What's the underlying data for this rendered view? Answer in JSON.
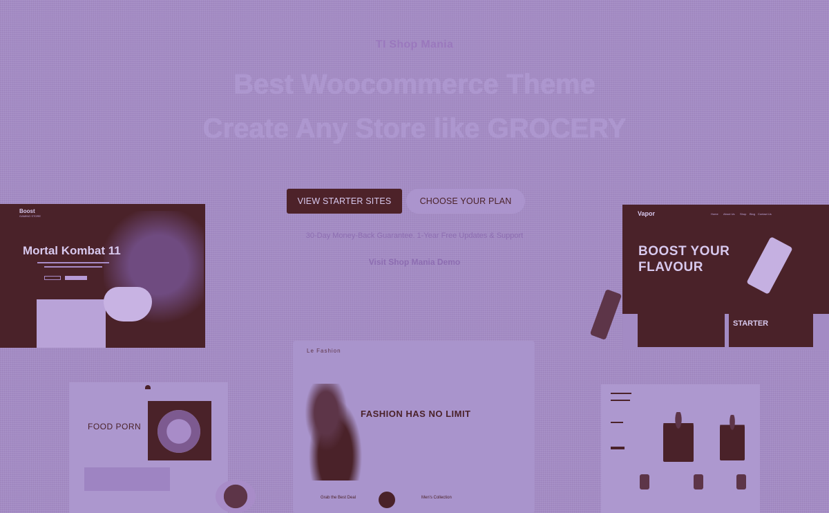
{
  "hero": {
    "eyebrow": "TI Shop Mania",
    "headline_1": "Best Woocommerce Theme",
    "headline_2": "Create Any Store like GROCERY",
    "primary_button": "VIEW STARTER SITES",
    "secondary_button": "CHOOSE YOUR PLAN",
    "note": "30-Day Money-Back Guarantee. 1-Year Free Updates & Support",
    "cta_link": "Visit Shop Mania Demo"
  },
  "previews": {
    "mortal_kombat": {
      "brand": "Boost",
      "brand_sub": "GAMING STORE",
      "title": "Mortal Kombat 11"
    },
    "vapor": {
      "logo": "Vapor",
      "nav": [
        "Home",
        "About Us",
        "Shop",
        "Blog",
        "Contact Us"
      ],
      "title_line_1": "BOOST YOUR",
      "title_line_2": "FLAVOUR",
      "tile_1": "",
      "tile_2": "STARTER"
    },
    "fashion": {
      "logo": "Le Fashion",
      "title": "FASHION HAS NO LIMIT",
      "footer_1": "Grab the Best Deal",
      "footer_2": "Men's Collection"
    },
    "food": {
      "title": "FOOD PORN"
    }
  },
  "colors": {
    "background": "#a38bc4",
    "dark": "#4a2229",
    "heading": "#ad97cf",
    "muted": "#8d6db1"
  }
}
